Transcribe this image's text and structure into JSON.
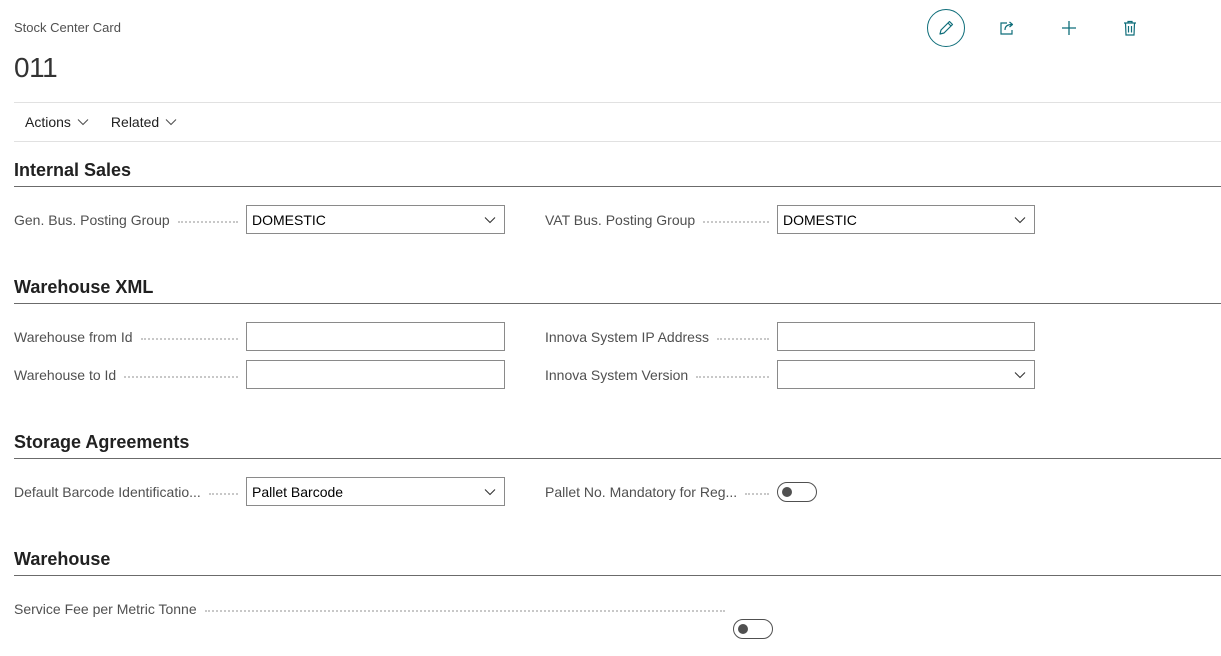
{
  "header": {
    "caption": "Stock Center Card",
    "title": "011"
  },
  "action_bar": {
    "actions_label": "Actions",
    "related_label": "Related"
  },
  "sections": {
    "internal_sales": {
      "title": "Internal Sales",
      "gen_bus_posting_group": {
        "label": "Gen. Bus. Posting Group",
        "value": "DOMESTIC"
      },
      "vat_bus_posting_group": {
        "label": "VAT Bus. Posting Group",
        "value": "DOMESTIC"
      }
    },
    "warehouse_xml": {
      "title": "Warehouse XML",
      "warehouse_from_id": {
        "label": "Warehouse from Id",
        "value": ""
      },
      "warehouse_to_id": {
        "label": "Warehouse to Id",
        "value": ""
      },
      "innova_ip": {
        "label": "Innova System IP Address",
        "value": ""
      },
      "innova_version": {
        "label": "Innova System Version",
        "value": ""
      }
    },
    "storage_agreements": {
      "title": "Storage Agreements",
      "default_barcode": {
        "label": "Default Barcode Identificatio...",
        "value": "Pallet Barcode"
      },
      "pallet_mandatory": {
        "label": "Pallet No. Mandatory for Reg...",
        "value": false
      }
    },
    "warehouse": {
      "title": "Warehouse",
      "service_fee": {
        "label": "Service Fee per Metric Tonne",
        "value": false
      }
    }
  },
  "colors": {
    "accent": "#0f6e7a",
    "section_rule": "#6b6b6b",
    "label_text": "#505050"
  },
  "icons": [
    "edit-icon",
    "share-icon",
    "add-icon",
    "delete-icon",
    "chevron-down-icon"
  ]
}
